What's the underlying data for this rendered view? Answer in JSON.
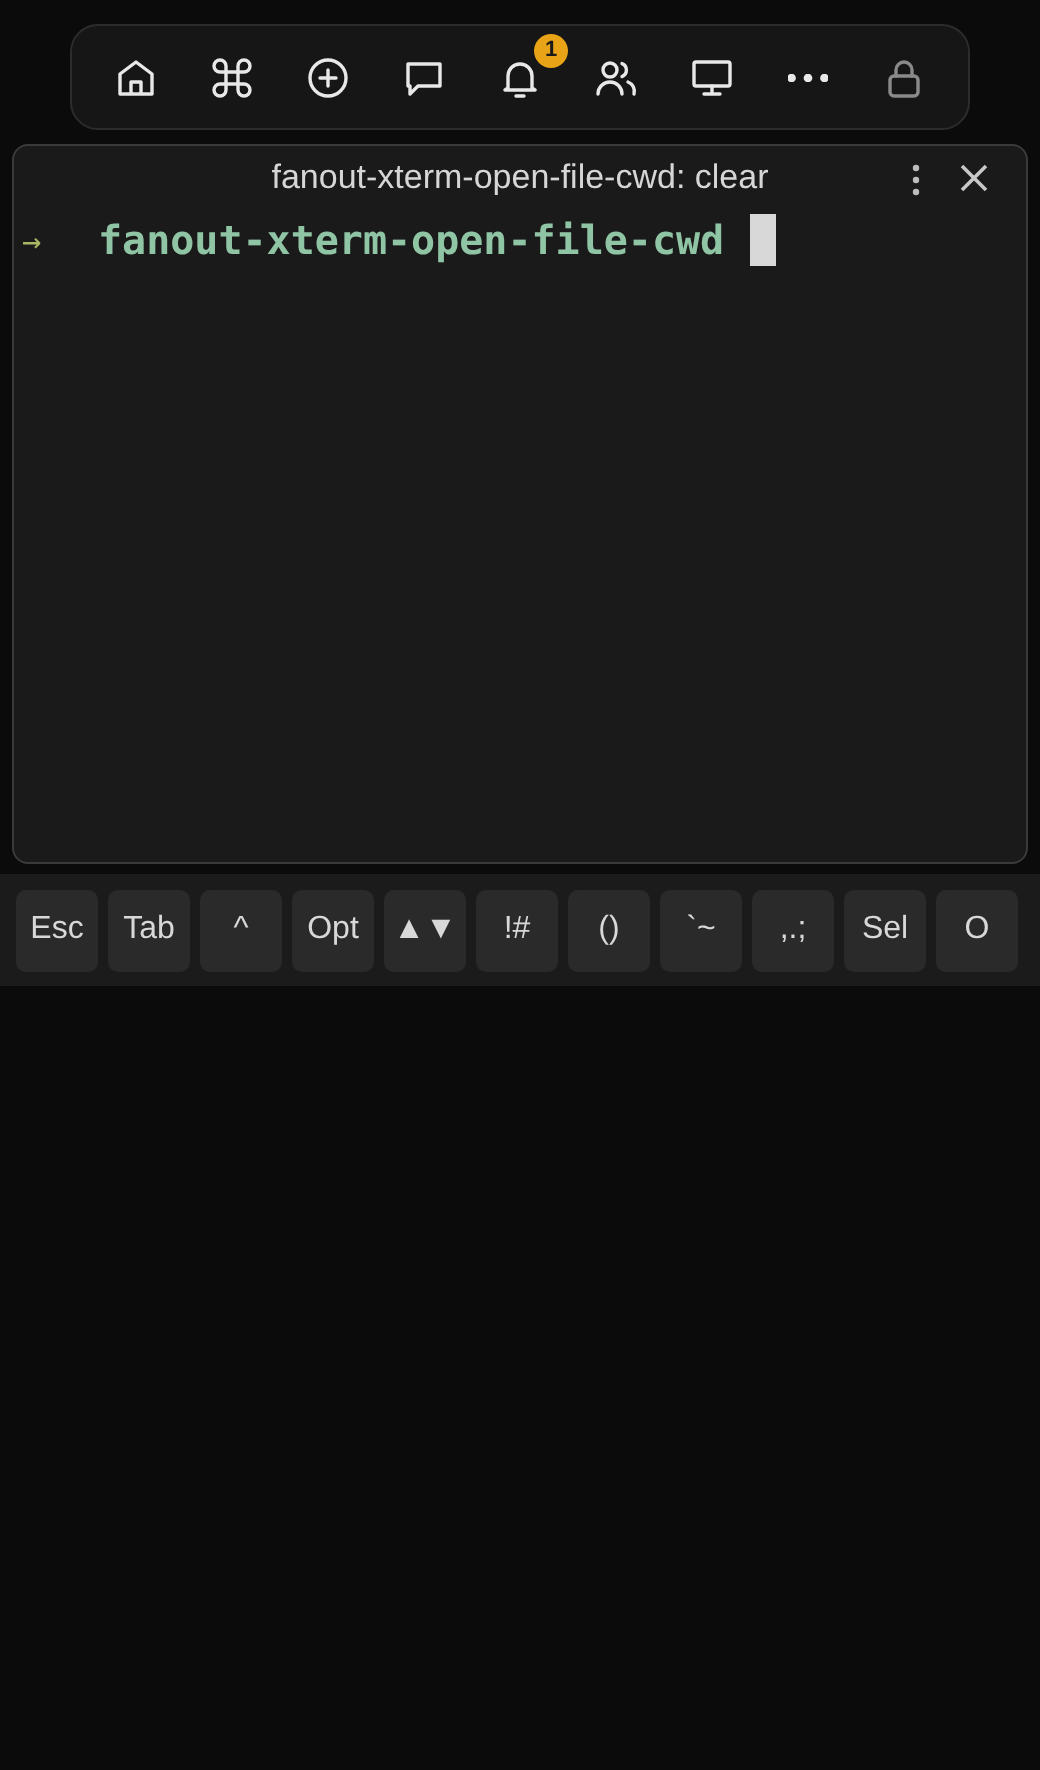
{
  "nav": {
    "items": [
      {
        "kind": "home",
        "disabled": false
      },
      {
        "kind": "command",
        "disabled": false
      },
      {
        "kind": "plus-circle",
        "disabled": false
      },
      {
        "kind": "chat",
        "disabled": false
      },
      {
        "kind": "bell",
        "disabled": false,
        "badge": "1"
      },
      {
        "kind": "users",
        "disabled": false
      },
      {
        "kind": "monitor",
        "disabled": false
      },
      {
        "kind": "more",
        "disabled": false
      },
      {
        "kind": "lock",
        "disabled": true
      }
    ]
  },
  "terminal": {
    "title": "fanout-xterm-open-file-cwd: clear",
    "prompt_symbol": "→",
    "prompt_dir": "fanout-xterm-open-file-cwd"
  },
  "keys": [
    "Esc",
    "Tab",
    "^",
    "Opt",
    "▲▼",
    "!#",
    "()",
    "`~",
    ",.;",
    "Sel",
    "O"
  ]
}
